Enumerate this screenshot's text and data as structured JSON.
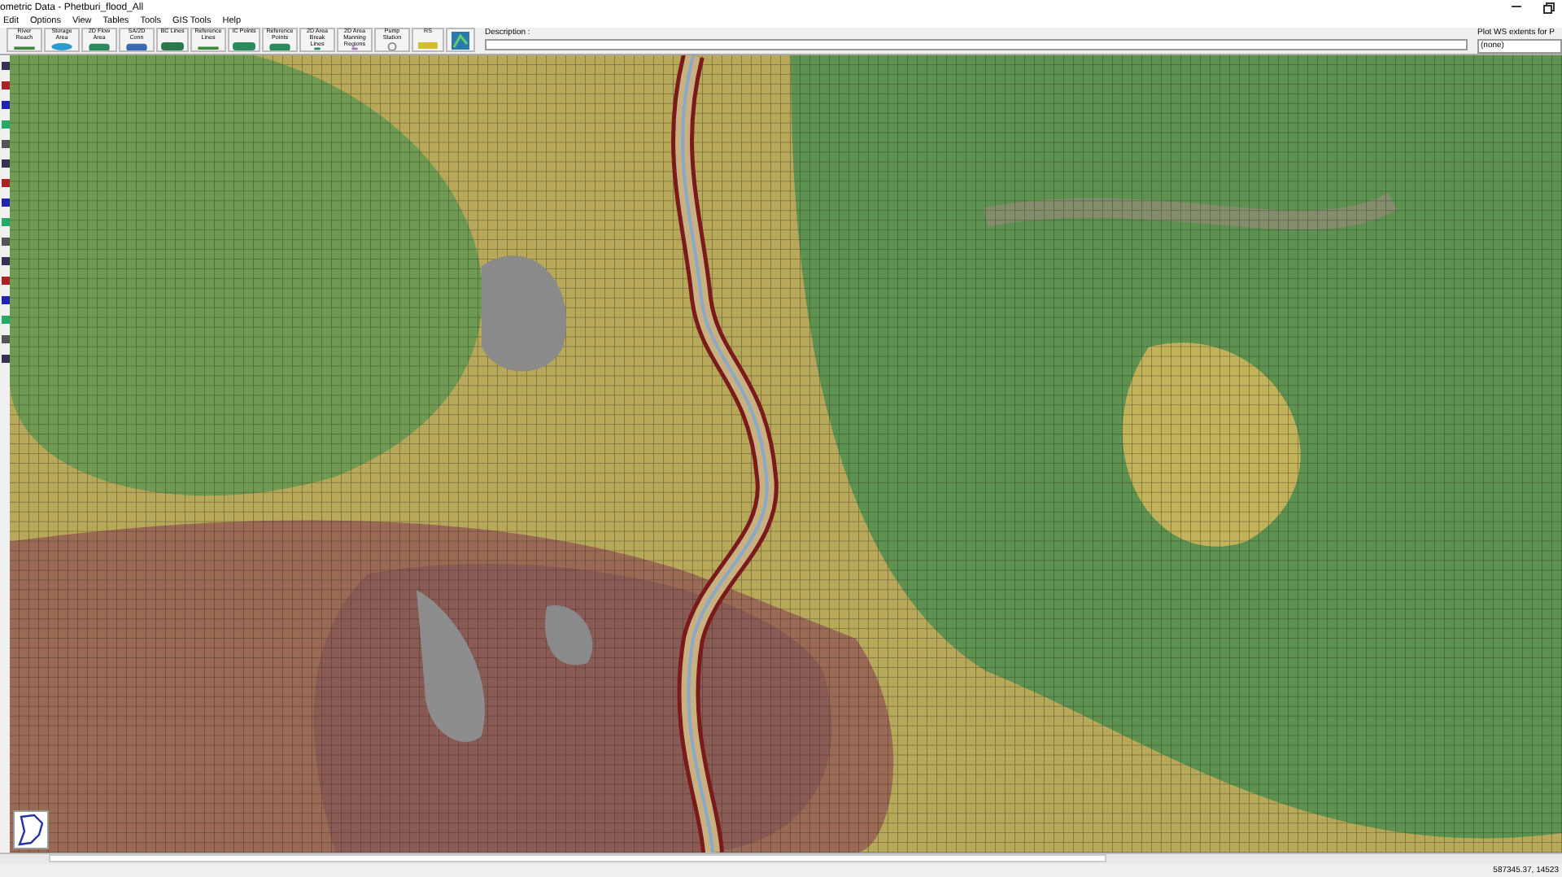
{
  "window": {
    "title": "ometric Data - Phetburi_flood_All"
  },
  "menu": [
    "Edit",
    "Options",
    "View",
    "Tables",
    "Tools",
    "GIS Tools",
    "Help"
  ],
  "toolbar": [
    {
      "label": "River Reach",
      "kind": "line"
    },
    {
      "label": "Storage Area",
      "kind": "area"
    },
    {
      "label": "2D Flow Area",
      "kind": "grid"
    },
    {
      "label": "SA/2D Conn",
      "kind": "conn"
    },
    {
      "label": "BC Lines",
      "kind": "bc"
    },
    {
      "label": "Reference Lines",
      "kind": "line"
    },
    {
      "label": "IC Points",
      "kind": "grid"
    },
    {
      "label": "Reference Points",
      "kind": "grid"
    },
    {
      "label": "2D Area Break Lines",
      "kind": "grid"
    },
    {
      "label": "2D Area Manning Regions",
      "kind": "region"
    },
    {
      "label": "Pump Station",
      "kind": "pump"
    },
    {
      "label": "RS",
      "kind": "rs"
    }
  ],
  "description": {
    "label": "Description :"
  },
  "plot_ws": {
    "label": "Plot WS extents for P",
    "value": "(none)"
  },
  "status_bar": {
    "coordinates": "587345.37, 14523"
  }
}
